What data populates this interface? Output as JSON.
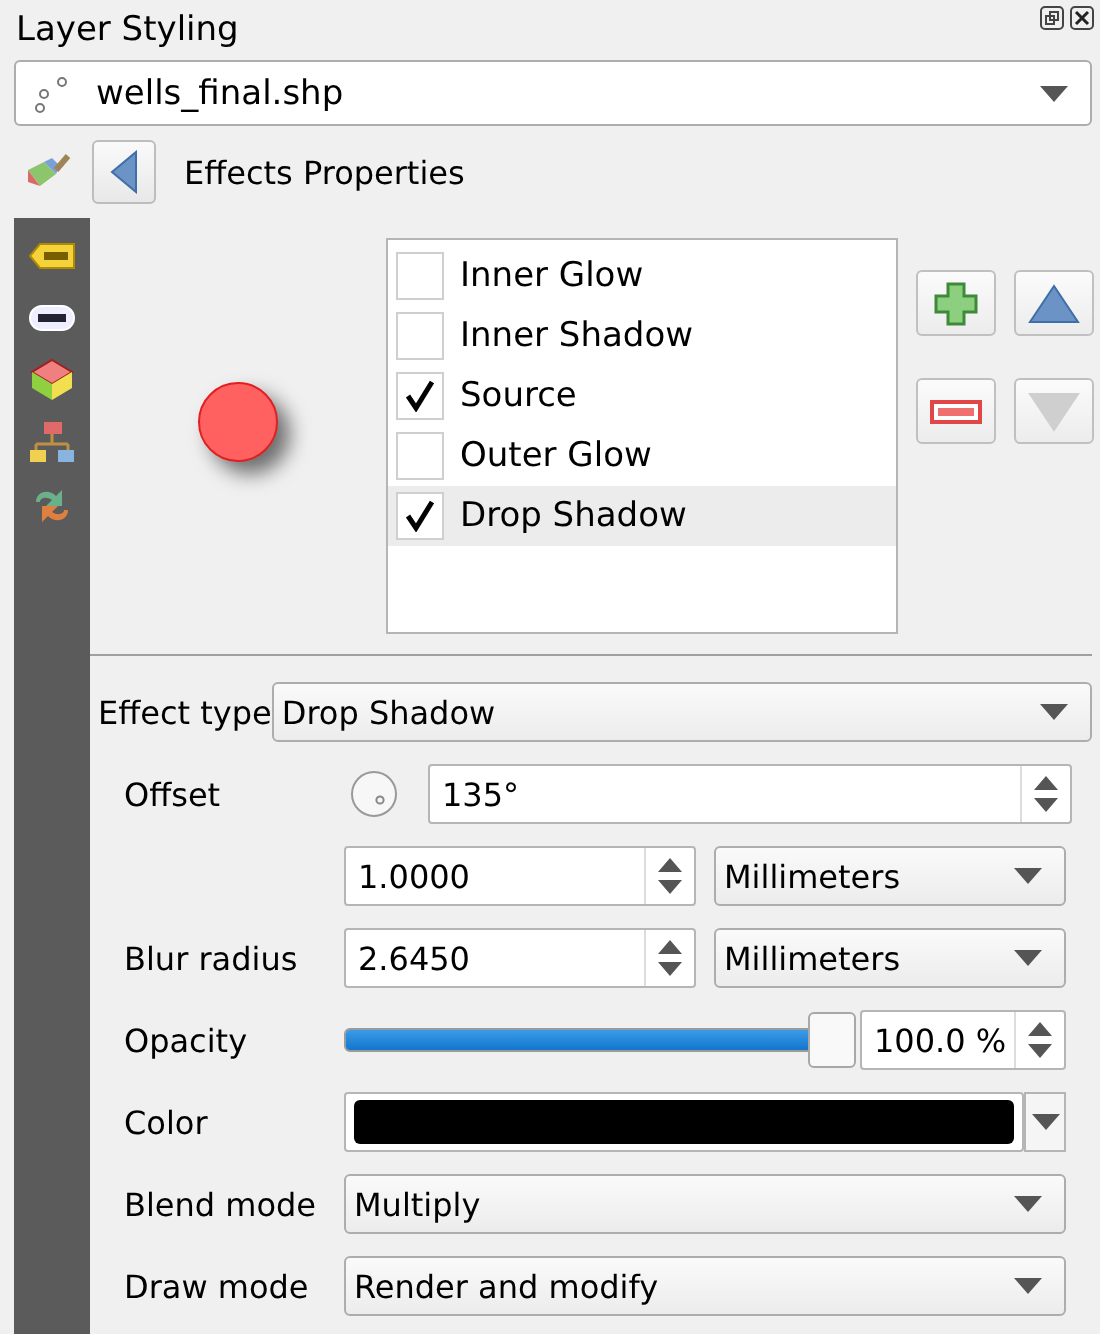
{
  "panel": {
    "title": "Layer Styling"
  },
  "layer": {
    "value": "wells_final.shp"
  },
  "header": {
    "title": "Effects Properties"
  },
  "effects": [
    {
      "label": "Inner Glow",
      "checked": false,
      "selected": false
    },
    {
      "label": "Inner Shadow",
      "checked": false,
      "selected": false
    },
    {
      "label": "Source",
      "checked": true,
      "selected": false
    },
    {
      "label": "Outer Glow",
      "checked": false,
      "selected": false
    },
    {
      "label": "Drop Shadow",
      "checked": true,
      "selected": true
    }
  ],
  "list_buttons": [
    {
      "kind": "add",
      "disabled": false
    },
    {
      "kind": "up",
      "disabled": false
    },
    {
      "kind": "remove",
      "disabled": false
    },
    {
      "kind": "down",
      "disabled": true
    }
  ],
  "effect_type": {
    "label": "Effect type",
    "value": "Drop Shadow"
  },
  "offset": {
    "label": "Offset",
    "angle": "135°",
    "distance": "1.0000",
    "unit": "Millimeters"
  },
  "blur": {
    "label": "Blur radius",
    "value": "2.6450",
    "unit": "Millimeters"
  },
  "opacity": {
    "label": "Opacity",
    "level": 1.0,
    "reading": "100.0 %"
  },
  "color": {
    "label": "Color",
    "color": "#000000"
  },
  "blend_mode": {
    "label": "Blend mode",
    "value": "Multiply"
  },
  "draw_mode": {
    "label": "Draw mode",
    "value": "Render and modify"
  }
}
